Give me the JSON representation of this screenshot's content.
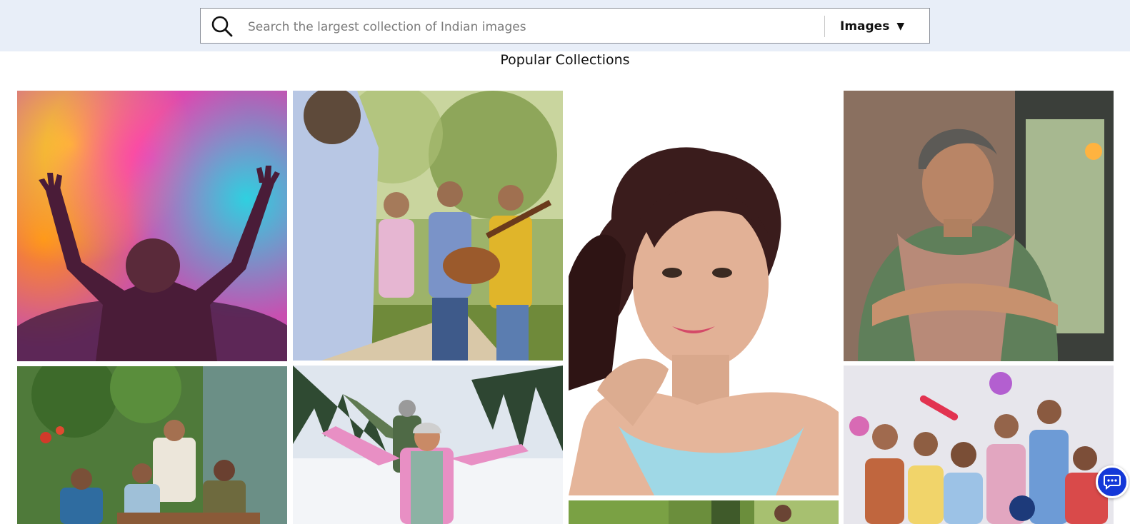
{
  "search": {
    "placeholder": "Search the largest collection of Indian images",
    "icon": "search-icon",
    "type_label": "Images",
    "type_caret": "▼"
  },
  "section": {
    "title": "Popular Collections"
  },
  "collections": [
    {
      "subject": "holi-colors-raised-hands"
    },
    {
      "subject": "seniors-playing-guitar-park"
    },
    {
      "subject": "smiling-woman-portrait"
    },
    {
      "subject": "woman-in-apron-shop"
    },
    {
      "subject": "friends-outdoor-lunch"
    },
    {
      "subject": "girl-in-snow"
    },
    {
      "subject": "garden-partial"
    },
    {
      "subject": "cheering-group-fans"
    }
  ],
  "chat": {
    "icon": "chat-icon",
    "accent": "#1438d8"
  },
  "colors": {
    "topbar_bg": "#e8eef8",
    "border": "#8a8f98"
  }
}
